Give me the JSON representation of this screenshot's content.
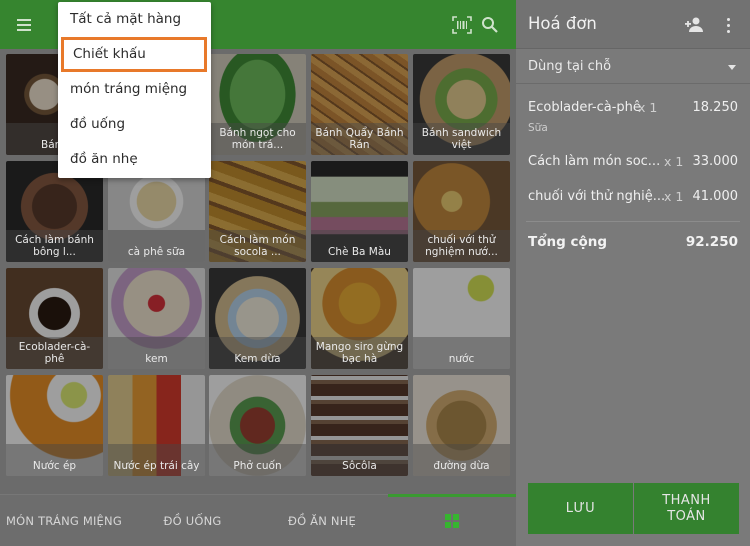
{
  "topbar": {
    "menu_icon": "hamburger-menu-icon",
    "barcode_icon": "barcode-scan-icon",
    "search_icon": "search-icon"
  },
  "dropdown": {
    "items": [
      {
        "label": "Tất cả mặt hàng"
      },
      {
        "label": "Chiết khấu",
        "highlighted": true
      },
      {
        "label": "món tráng miệng"
      },
      {
        "label": "đồ uống"
      },
      {
        "label": "đồ ăn nhẹ"
      }
    ]
  },
  "products": [
    {
      "label": "Bánh"
    },
    {
      "label": ""
    },
    {
      "label": "Bánh ngọt cho món trá..."
    },
    {
      "label": "Bánh Quẩy Bánh Rán"
    },
    {
      "label": "Bánh sandwich việt"
    },
    {
      "label": "Cách làm bánh bông l..."
    },
    {
      "label": "cà phê sữa"
    },
    {
      "label": "Cách làm món socola ..."
    },
    {
      "label": "Chè Ba Màu"
    },
    {
      "label": "chuối với thử nghiệm nướ..."
    },
    {
      "label": "Ecoblader-cà-phê"
    },
    {
      "label": "kem"
    },
    {
      "label": "Kem dừa"
    },
    {
      "label": "Mango siro gừng bạc hà"
    },
    {
      "label": "nước"
    },
    {
      "label": "Nước ép"
    },
    {
      "label": "Nước ép trái cây"
    },
    {
      "label": "Phở cuốn"
    },
    {
      "label": "Sôcôla"
    },
    {
      "label": "đường dừa"
    }
  ],
  "categories": [
    {
      "label": "MÓN TRÁNG MIỆNG"
    },
    {
      "label": "ĐỒ UỐNG"
    },
    {
      "label": "ĐỒ ĂN NHẸ"
    }
  ],
  "grid_icon": "grid-view-icon",
  "invoice": {
    "title": "Hoá đơn",
    "add_customer_icon": "add-person-icon",
    "more_icon": "more-vertical-icon",
    "order_type": "Dùng tại chỗ",
    "lines": [
      {
        "name": "Ecoblader-cà-phê",
        "qty": "x 1",
        "amount": "18.250",
        "note": "Sữa"
      },
      {
        "name": "Cách làm món soc...",
        "qty": "x 1",
        "amount": "33.000",
        "note": ""
      },
      {
        "name": "chuối với thử nghiệ...",
        "qty": "x 1",
        "amount": "41.000",
        "note": ""
      }
    ],
    "total_label": "Tổng cộng",
    "total_value": "92.250",
    "save_label": "LƯU",
    "pay_label_1": "THANH",
    "pay_label_2": "TOÁN"
  },
  "colors": {
    "brand_green": "#36852f",
    "highlight_orange": "#e8792a",
    "overlay_gray": "#6b6b6b"
  }
}
